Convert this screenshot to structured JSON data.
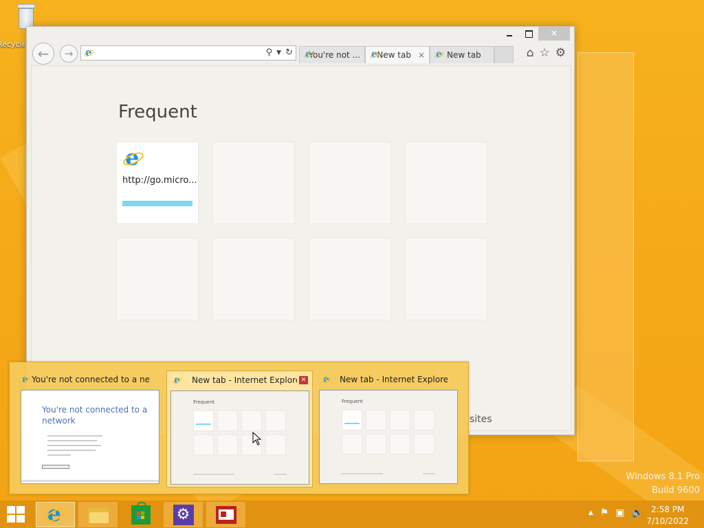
{
  "desktop": {
    "recycle_bin_label": "Recycle Bin"
  },
  "ie": {
    "address_value": "",
    "tabs": [
      {
        "label": "You're not ..."
      },
      {
        "label": "New tab",
        "close": "×"
      },
      {
        "label": "New tab"
      }
    ],
    "new_tab_page": {
      "heading": "Frequent",
      "tiles": [
        {
          "label": "http://go.micro..."
        }
      ],
      "more_sites_label": "sites"
    }
  },
  "thumbnails": [
    {
      "title": "You're not connected to a netw...",
      "heading": "You're not connected to a network"
    },
    {
      "title": "New tab - Internet Explorer",
      "mini_heading": "Frequent"
    },
    {
      "title": "New tab - Internet Explorer",
      "mini_heading": "Frequent"
    }
  ],
  "watermark": {
    "line1": "Windows 8.1 Pro",
    "line2": "Build 9600"
  },
  "clock": {
    "time": "2:58 PM",
    "date": "7/10/2022"
  },
  "colors": {
    "accent": "#f6b21d",
    "ie_blue": "#1f8fe0",
    "tile_bar": "#7fd8ef",
    "taskbar": "#e09010"
  },
  "icons": [
    "recycle-bin-icon",
    "ie-icon",
    "file-explorer-icon",
    "store-icon",
    "settings-icon",
    "news-icon",
    "windows-logo-icon",
    "flag-icon",
    "network-icon",
    "speaker-muted-icon"
  ]
}
